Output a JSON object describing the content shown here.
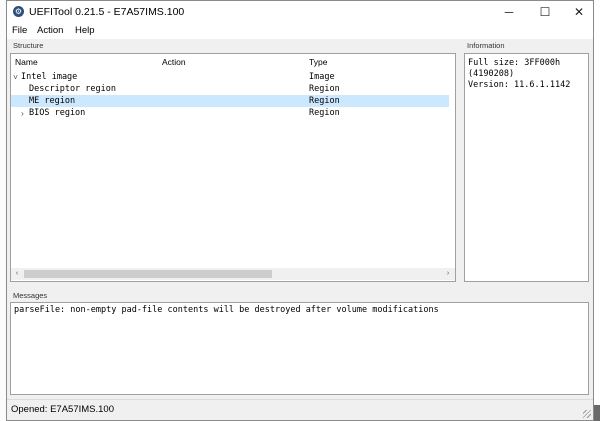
{
  "window": {
    "title": "UEFITool 0.21.5 - E7A57IMS.100",
    "controls": {
      "minimize": "─",
      "maximize": "☐",
      "close": "✕"
    }
  },
  "menu": {
    "file": "File",
    "action": "Action",
    "help": "Help"
  },
  "structure": {
    "group_label": "Structure",
    "columns": {
      "name": "Name",
      "action": "Action",
      "type": "Type"
    },
    "rows": [
      {
        "name": "Intel image",
        "action": "",
        "type": "Image",
        "expander": "˅",
        "selected": false
      },
      {
        "name": "Descriptor region",
        "action": "",
        "type": "Region",
        "expander": "",
        "selected": false
      },
      {
        "name": "ME region",
        "action": "",
        "type": "Region",
        "expander": "",
        "selected": true
      },
      {
        "name": "BIOS region",
        "action": "",
        "type": "Region",
        "expander": "›",
        "selected": false
      }
    ]
  },
  "information": {
    "group_label": "Information",
    "lines": [
      "Full size: 3FF000h",
      "(4190208)",
      "Version: 11.6.1.1142"
    ]
  },
  "messages": {
    "group_label": "Messages",
    "lines": [
      "parseFile: non-empty pad-file contents will be destroyed after volume modifications"
    ]
  },
  "status": {
    "text": "Opened: E7A57IMS.100"
  },
  "icons": {
    "app": "uefitool-gear-icon",
    "scroll_left": "‹",
    "scroll_right": "›"
  },
  "colors": {
    "selection": "#cce8ff",
    "window_bg": "#f0f0f0",
    "panel_bg": "#ffffff"
  }
}
